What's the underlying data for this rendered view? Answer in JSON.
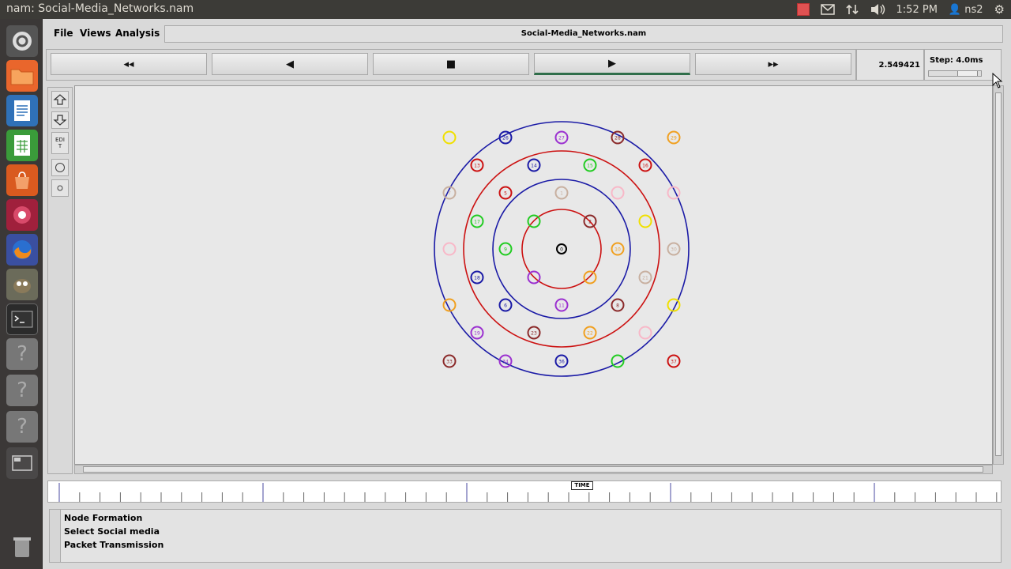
{
  "system": {
    "window_title": "nam: Social-Media_Networks.nam",
    "clock": "1:52 PM",
    "user": "ns2",
    "tray_icons": [
      "indicator-red-square-icon",
      "mail-icon",
      "network-arrows-icon",
      "volume-icon",
      "user-icon",
      "gear-icon"
    ]
  },
  "launcher": {
    "items": [
      {
        "name": "dash-home",
        "icon": "ubuntu-logo-icon"
      },
      {
        "name": "files",
        "icon": "folder-icon"
      },
      {
        "name": "writer",
        "icon": "document-icon"
      },
      {
        "name": "calc",
        "icon": "spreadsheet-icon"
      },
      {
        "name": "software-center",
        "icon": "shopping-bag-icon"
      },
      {
        "name": "app-red",
        "icon": "red-app-icon"
      },
      {
        "name": "firefox",
        "icon": "firefox-icon"
      },
      {
        "name": "gimp",
        "icon": "gimp-icon"
      },
      {
        "name": "terminal",
        "icon": "terminal-icon"
      },
      {
        "name": "unknown-1",
        "icon": "question-icon",
        "label": "?"
      },
      {
        "name": "unknown-2",
        "icon": "question-icon",
        "label": "?"
      },
      {
        "name": "unknown-3",
        "icon": "question-icon",
        "label": "?"
      },
      {
        "name": "workspace-switcher",
        "icon": "workspace-icon"
      },
      {
        "name": "trash",
        "icon": "trash-icon"
      }
    ]
  },
  "menu": {
    "file": "File",
    "views": "Views",
    "analysis": "Analysis",
    "filename": "Social-Media_Networks.nam"
  },
  "controls": {
    "buttons": [
      {
        "name": "rewind",
        "glyph": "◂◂"
      },
      {
        "name": "back",
        "glyph": "◀"
      },
      {
        "name": "stop",
        "glyph": "■"
      },
      {
        "name": "play",
        "glyph": "▶"
      },
      {
        "name": "fast-forward",
        "glyph": "▸▸"
      }
    ],
    "time": "2.549421",
    "step": "Step: 4.0ms"
  },
  "tools": {
    "zoom_in": "zoom-in-icon",
    "zoom_out": "zoom-out-icon",
    "edit": "EDIT",
    "circle_large": "circle-icon",
    "circle_small": "small-circle-icon"
  },
  "timeline": {
    "time_label": "TIME"
  },
  "annotations": [
    "Node Formation",
    "Select Social media",
    "Packet Transmission"
  ],
  "colors": {
    "ring_blue": "#1a1aa6",
    "ring_red": "#cc1111",
    "active_play": "#2f6e4a"
  },
  "network": {
    "center_label": "0",
    "nodes": [
      {
        "label": "",
        "color": "#f0e000"
      },
      {
        "label": "26",
        "color": "#1a1aa6"
      },
      {
        "label": "27",
        "color": "#9b30d0"
      },
      {
        "label": "28",
        "color": "#8b2a2a"
      },
      {
        "label": "29",
        "color": "#f0a020"
      },
      {
        "label": "13",
        "color": "#cc1111"
      },
      {
        "label": "14",
        "color": "#1a1aa6"
      },
      {
        "label": "15",
        "color": "#22cc22"
      },
      {
        "label": "16",
        "color": "#cc1111"
      },
      {
        "label": "7",
        "color": "#c8b0a0"
      },
      {
        "label": "5",
        "color": "#cc1111"
      },
      {
        "label": "1",
        "color": "#c8b0a0"
      },
      {
        "label": "",
        "color": "#f8b8c8"
      },
      {
        "label": "",
        "color": "#f8b8c8"
      },
      {
        "label": "17",
        "color": "#22cc22"
      },
      {
        "label": "",
        "color": "#22cc22"
      },
      {
        "label": "2",
        "color": "#8b2a2a"
      },
      {
        "label": "",
        "color": "#f0e000"
      },
      {
        "label": "",
        "color": "#f8b8c8"
      },
      {
        "label": "9",
        "color": "#22cc22"
      },
      {
        "label": "10",
        "color": "#f0a020"
      },
      {
        "label": "30",
        "color": "#c8b0a0"
      },
      {
        "label": "18",
        "color": "#1a1aa6"
      },
      {
        "label": "",
        "color": "#9b30d0"
      },
      {
        "label": "",
        "color": "#f0a020"
      },
      {
        "label": "21",
        "color": "#c8b0a0"
      },
      {
        "label": "",
        "color": "#f0a020"
      },
      {
        "label": "6",
        "color": "#1a1aa6"
      },
      {
        "label": "11",
        "color": "#9b30d0"
      },
      {
        "label": "8",
        "color": "#8b2a2a"
      },
      {
        "label": "",
        "color": "#f0e000"
      },
      {
        "label": "19",
        "color": "#9b30d0"
      },
      {
        "label": "23",
        "color": "#8b2a2a"
      },
      {
        "label": "22",
        "color": "#f0a020"
      },
      {
        "label": "",
        "color": "#f8b8c8"
      },
      {
        "label": "33",
        "color": "#8b2a2a"
      },
      {
        "label": "34",
        "color": "#9b30d0"
      },
      {
        "label": "36",
        "color": "#1a1aa6"
      },
      {
        "label": "",
        "color": "#22cc22"
      },
      {
        "label": "37",
        "color": "#cc1111"
      }
    ]
  }
}
